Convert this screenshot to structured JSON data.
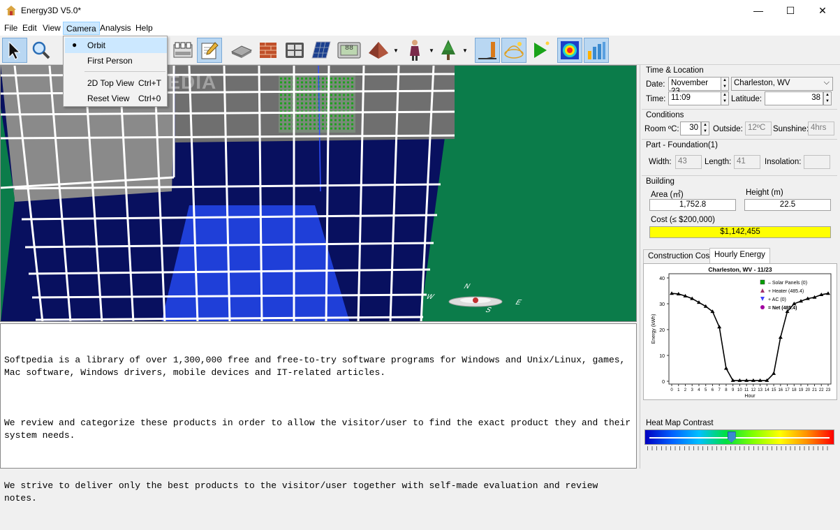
{
  "window": {
    "title": "Energy3D V5.0*",
    "minimize": "—",
    "maximize": "☐",
    "close": "✕"
  },
  "menubar": {
    "items": [
      "File",
      "Edit",
      "View",
      "Camera",
      "Analysis",
      "Help"
    ],
    "active": "Camera"
  },
  "camera_menu": {
    "items": [
      {
        "label": "Orbit",
        "shortcut": "",
        "checked": true
      },
      {
        "label": "First Person",
        "shortcut": ""
      },
      {
        "label": "2D Top View",
        "shortcut": "Ctrl+T"
      },
      {
        "label": "Reset View",
        "shortcut": "Ctrl+0"
      }
    ]
  },
  "toolbar": {
    "icons": [
      "select-arrow-icon",
      "zoom-icon",
      "note-icon",
      "edit-icon",
      "foundation-icon",
      "wall-icon",
      "window-icon",
      "solar-panel-icon",
      "thermostat-icon",
      "roof-icon",
      "human-icon",
      "tree-icon",
      "shadow-icon",
      "sun-path-icon",
      "run-simulation-icon",
      "heat-map-icon",
      "energy-graph-icon"
    ],
    "thermostat_display": "88"
  },
  "viewport": {
    "watermark": "SOFTPEDIA",
    "compass": {
      "n": "N",
      "e": "E",
      "s": "S",
      "w": "W"
    }
  },
  "console": {
    "paragraphs": [
      "Softpedia is a library of over 1,300,000 free and free-to-try software programs for Windows and Unix/Linux, games, Mac software, Windows drivers, mobile devices and IT-related articles.",
      "We review and categorize these products in order to allow the visitor/user to find the exact product they and their system needs.",
      "We strive to deliver only the best products to the visitor/user together with self-made evaluation and review notes."
    ]
  },
  "panel": {
    "time_location": {
      "title": "Time & Location",
      "date_label": "Date:",
      "date_value": "November 23",
      "location_value": "Charleston, WV",
      "time_label": "Time:",
      "time_value": "11:09",
      "latitude_label": "Latitude:",
      "latitude_value": "38"
    },
    "conditions": {
      "title": "Conditions",
      "room_label": "Room ºC:",
      "room_value": "30",
      "outside_label": "Outside:",
      "outside_value": "12ºC",
      "sunshine_label": "Sunshine:",
      "sunshine_value": "4hrs"
    },
    "part": {
      "title": "Part - Foundation(1)",
      "width_label": "Width:",
      "width_value": "43",
      "length_label": "Length:",
      "length_value": "41",
      "insolation_label": "Insolation:",
      "insolation_value": ""
    },
    "building": {
      "title": "Building",
      "area_label": "Area (㎡)",
      "area_value": "1,752.8",
      "height_label": "Height (m)",
      "height_value": "22.5",
      "cost_label": "Cost (≤ $200,000)",
      "cost_value": "$1,142,455"
    },
    "tabs": [
      "Construction Cost",
      "Hourly Energy"
    ],
    "active_tab": "Hourly Energy",
    "heatmap": {
      "title": "Heat Map Contrast",
      "value_fraction": 0.45
    }
  },
  "colors": {
    "ground": "#0b7c4a",
    "cost_bar": "#ffff00",
    "selected_tool": "#b9d7f2",
    "menu_highlight": "#cce8ff"
  },
  "chart_data": {
    "type": "line",
    "title": "Charleston, WV - 11/23",
    "xlabel": "Hour",
    "ylabel": "Energy (kWh)",
    "xlim": [
      0,
      23
    ],
    "ylim": [
      0,
      40
    ],
    "x": [
      0,
      1,
      2,
      3,
      4,
      5,
      6,
      7,
      8,
      9,
      10,
      11,
      12,
      13,
      14,
      15,
      16,
      17,
      18,
      19,
      20,
      21,
      22,
      23
    ],
    "yticks": [
      0,
      10,
      20,
      30,
      40
    ],
    "legend": [
      {
        "label": "– Solar Panels (0)",
        "marker": "square",
        "color": "#00a000"
      },
      {
        "label": "+ Heater (485.4)",
        "marker": "triangle-up",
        "color": "#a0306a"
      },
      {
        "label": "+ AC (0)",
        "marker": "triangle-down",
        "color": "#4040ff"
      },
      {
        "label": "= Net (485.4)",
        "marker": "circle",
        "color": "#a000a0",
        "bold": true
      }
    ],
    "legend_position": "top-right",
    "series": [
      {
        "name": "Heater",
        "values": [
          34,
          33.8,
          33,
          32,
          30.5,
          29,
          27,
          21,
          5,
          0.3,
          0.3,
          0.3,
          0.3,
          0.3,
          0.3,
          3,
          17,
          27,
          30,
          31,
          32,
          32.5,
          33.5,
          34
        ]
      }
    ]
  }
}
